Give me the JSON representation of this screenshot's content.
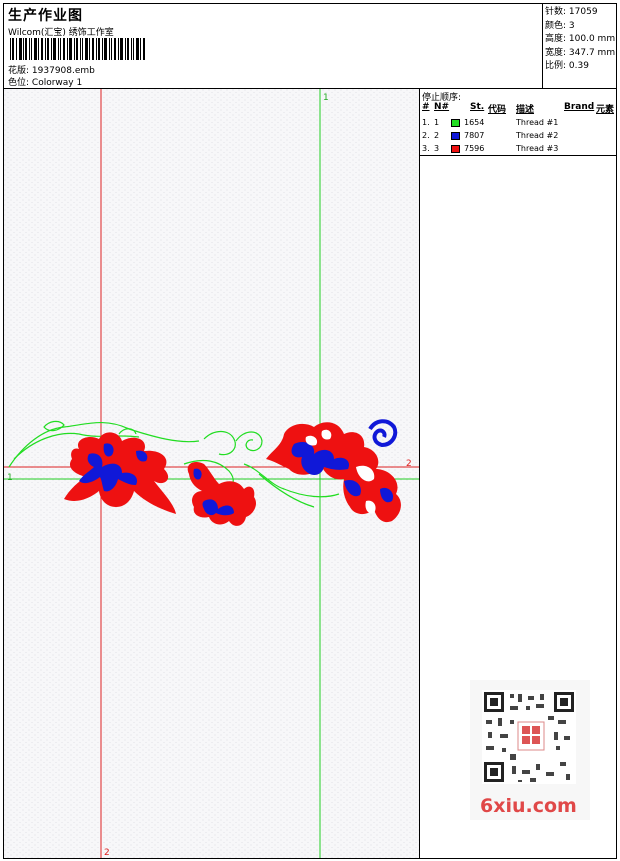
{
  "header": {
    "title": "生产作业图",
    "company": "Wilcom(汇宝) 绣饰工作室",
    "file_label": "花版:",
    "file_value": "1937908.emb",
    "colorway_label": "色位:",
    "colorway_value": "Colorway 1"
  },
  "stats": [
    {
      "label": "针数:",
      "value": "17059"
    },
    {
      "label": "颜色:",
      "value": "3"
    },
    {
      "label": "高度:",
      "value": "100.0 mm"
    },
    {
      "label": "宽度:",
      "value": "347.7 mm"
    },
    {
      "label": "比例:",
      "value": "0.39"
    }
  ],
  "stop_sequence": {
    "title": "停止顺序:",
    "headers": {
      "stop": "#",
      "num": "N#",
      "st": "St.",
      "code": "代码",
      "desc": "描述",
      "brand": "Brand",
      "element": "元素"
    },
    "rows": [
      {
        "stop": "1.",
        "num": "1",
        "color": "#22dd22",
        "code": "1654",
        "desc": "Thread #1"
      },
      {
        "stop": "2.",
        "num": "2",
        "color": "#1018d8",
        "code": "7807",
        "desc": "Thread #2"
      },
      {
        "stop": "3.",
        "num": "3",
        "color": "#ee1111",
        "code": "7596",
        "desc": "Thread #3"
      }
    ]
  },
  "guides": {
    "top_green_label": "1",
    "left_label": "1",
    "right_label": "2",
    "bottom_red_label": "2"
  },
  "watermark": "6xiu.com",
  "colors": {
    "green": "#22dd22",
    "blue": "#1018d8",
    "red": "#ee1111"
  }
}
